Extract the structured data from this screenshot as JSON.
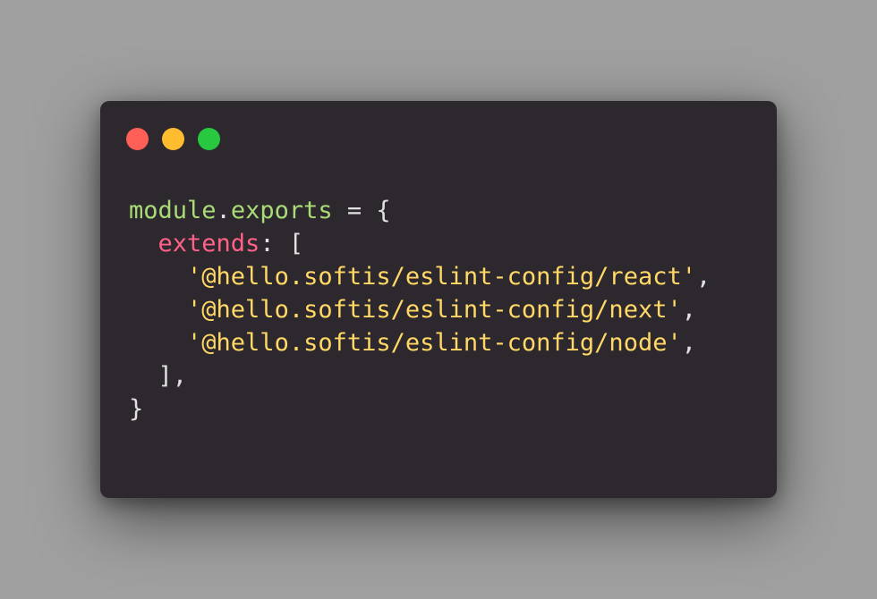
{
  "window": {
    "background": "#2d282e",
    "controls": [
      {
        "name": "close",
        "color": "#fe5f57"
      },
      {
        "name": "minimize",
        "color": "#febc2e"
      },
      {
        "name": "maximize",
        "color": "#28c840"
      }
    ]
  },
  "syntax_colors": {
    "identifier": "#a9dc76",
    "property_key": "#ff6188",
    "string": "#ffd866",
    "punctuation": "#e3e0e4"
  },
  "code": {
    "line1": {
      "obj": "module",
      "dot": ".",
      "prop": "exports",
      "rest": " = {"
    },
    "line2": {
      "indent": "  ",
      "key": "extends",
      "rest": ": ["
    },
    "entries": [
      {
        "indent": "    ",
        "value": "'@hello.softis/eslint-config/react'",
        "comma": ","
      },
      {
        "indent": "    ",
        "value": "'@hello.softis/eslint-config/next'",
        "comma": ","
      },
      {
        "indent": "    ",
        "value": "'@hello.softis/eslint-config/node'",
        "comma": ","
      }
    ],
    "line6": "  ],",
    "line7": "}"
  }
}
